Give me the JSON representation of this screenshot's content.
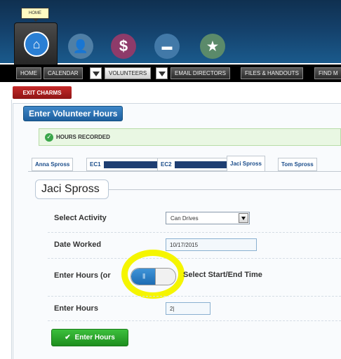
{
  "topnav": {
    "home_tooltip": "HOME",
    "icons": {
      "home": "⌂",
      "volunteers": "👤",
      "money": "$",
      "files": "▬",
      "star": "★"
    }
  },
  "menu": {
    "home": "HOME",
    "calendar": "CALENDAR",
    "volunteers": "VOLUNTEERS",
    "email_directors": "EMAIL DIRECTORS",
    "files_handouts": "FILES & HANDOUTS",
    "find": "FIND M"
  },
  "exit_label": "EXIT CHARMS",
  "panel_title": "Enter Volunteer Hours",
  "alert_text": "HOURS RECORDED",
  "tabs": [
    {
      "label": "Anna Spross"
    },
    {
      "label": "EC1"
    },
    {
      "label": "EC2"
    },
    {
      "label": "Jaci Spross"
    },
    {
      "label": "Tom Spross"
    }
  ],
  "section_title": "Jaci Spross",
  "form": {
    "activity_label": "Select Activity",
    "activity_value": "Can Drives",
    "date_label": "Date Worked",
    "date_value": "10/17/2015",
    "hours_mode_label": "Enter Hours (or",
    "hours_mode_alt": "Select Start/End Time",
    "hours_label": "Enter Hours",
    "hours_value": "2|",
    "submit_label": "Enter Hours"
  },
  "colors": {
    "accent": "#1d5f9e",
    "success": "#2e9b2e",
    "danger": "#b21d1d",
    "highlight": "#f5f500"
  }
}
